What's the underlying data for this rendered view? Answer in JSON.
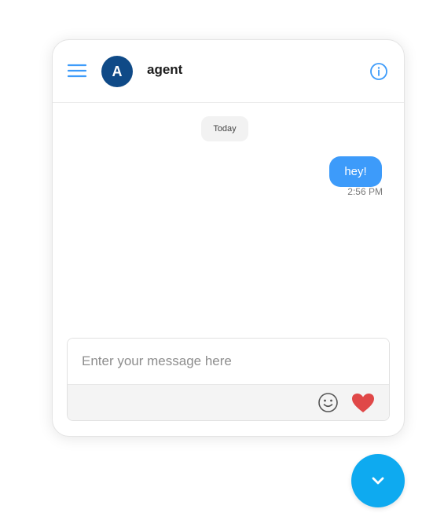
{
  "header": {
    "avatar_letter": "A",
    "agent_name": "agent"
  },
  "conversation": {
    "date_divider": "Today",
    "messages": [
      {
        "text": "hey!",
        "time": "2:56 PM",
        "sender": "user"
      }
    ]
  },
  "composer": {
    "placeholder": "Enter your message here"
  },
  "icons": {
    "menu": "hamburger-menu-icon",
    "info": "info-icon",
    "emoji": "smiley-face-icon",
    "heart": "heart-icon",
    "toggle": "chevron-down-icon"
  },
  "colors": {
    "accent": "#3d9bfa",
    "avatar_bg": "#0f4a87",
    "heart": "#e04848",
    "toggle_button": "#0eaaf0"
  }
}
